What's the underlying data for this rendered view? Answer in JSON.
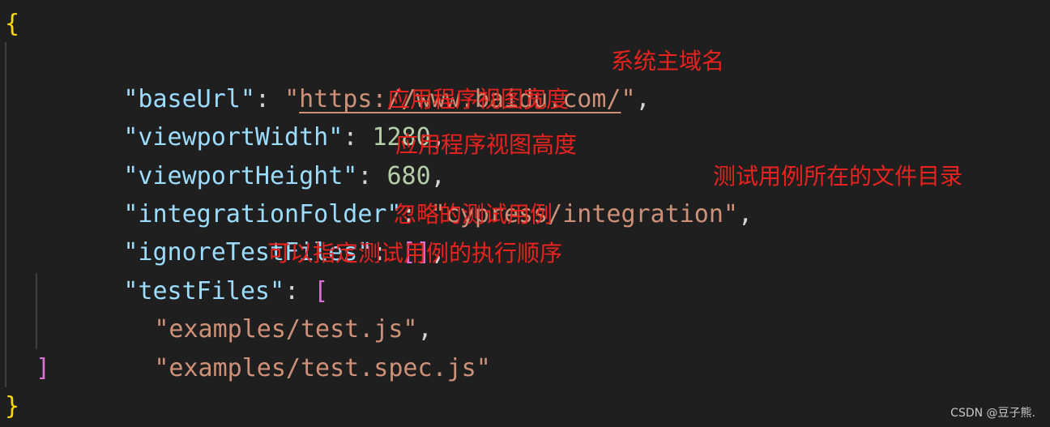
{
  "editor": {
    "open_brace": "{",
    "close_brace": "}",
    "lines": {
      "baseUrl": {
        "key": "\"baseUrl\"",
        "colon": ": ",
        "quote_open": "\"",
        "url": "https://www.baidu.com/",
        "quote_close": "\"",
        "comma": ",",
        "note": "系统主域名"
      },
      "viewportWidth": {
        "key": "\"viewportWidth\"",
        "colon": ": ",
        "value": "1280",
        "comma": ",",
        "note": "应用程序视图宽度"
      },
      "viewportHeight": {
        "key": "\"viewportHeight\"",
        "colon": ": ",
        "value": "680",
        "comma": ",",
        "note": "应用程序视图高度"
      },
      "integrationFolder": {
        "key": "\"integrationFolder\"",
        "colon": ": ",
        "value": "\"cypress/integration\"",
        "comma": ",",
        "note": "测试用例所在的文件目录"
      },
      "ignoreTestFiles": {
        "key": "\"ignoreTestFiles\"",
        "colon": ": ",
        "value": "[]",
        "comma": ",",
        "note": "忽略的测试用例"
      },
      "testFiles": {
        "key": "\"testFiles\"",
        "colon": ": ",
        "open_bracket": "[",
        "note": "可以指定测试用例的执行顺序",
        "items": [
          "\"examples/test.js\"",
          "\"examples/test.spec.js\""
        ],
        "item_comma": ",",
        "close_bracket": "]"
      }
    },
    "colors": {
      "background": "#1f1f1f",
      "key": "#9cdcfe",
      "string": "#ce9178",
      "number": "#b5cea8",
      "brace": "#ffd700",
      "bracket": "#da70d6",
      "annotation": "#e8231f"
    }
  },
  "watermark": "CSDN @豆子熊."
}
